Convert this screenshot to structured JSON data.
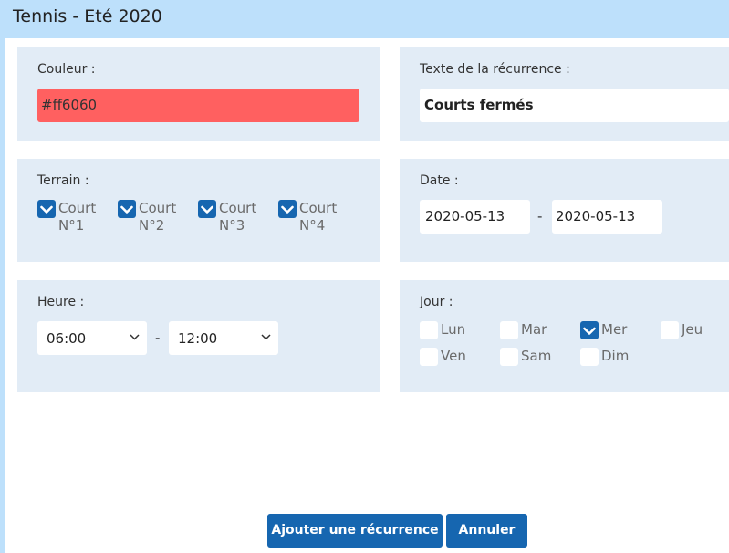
{
  "window": {
    "title": "Tennis - Eté 2020"
  },
  "couleur": {
    "label": "Couleur :",
    "value": "#ff6060",
    "swatch_color": "#ff6060"
  },
  "texte": {
    "label": "Texte de la récurrence :",
    "value": "Courts fermés"
  },
  "terrain": {
    "label": "Terrain :",
    "courts": [
      {
        "line1": "Court",
        "line2": "N°1",
        "checked": true
      },
      {
        "line1": "Court",
        "line2": "N°2",
        "checked": true
      },
      {
        "line1": "Court",
        "line2": "N°3",
        "checked": true
      },
      {
        "line1": "Court",
        "line2": "N°4",
        "checked": true
      }
    ]
  },
  "date": {
    "label": "Date :",
    "start": "2020-05-13",
    "separator": "-",
    "end": "2020-05-13"
  },
  "heure": {
    "label": "Heure :",
    "start": "06:00",
    "separator": "-",
    "end": "12:00"
  },
  "jour": {
    "label": "Jour :",
    "days": [
      {
        "label": "Lun",
        "checked": false
      },
      {
        "label": "Mar",
        "checked": false
      },
      {
        "label": "Mer",
        "checked": true
      },
      {
        "label": "Jeu",
        "checked": false
      },
      {
        "label": "Ven",
        "checked": false
      },
      {
        "label": "Sam",
        "checked": false
      },
      {
        "label": "Dim",
        "checked": false
      }
    ]
  },
  "buttons": {
    "add": "Ajouter une récurrence",
    "cancel": "Annuler"
  },
  "colors": {
    "accent": "#1666b0",
    "panel": "#e2ecf6",
    "titlebar": "#bde0fb"
  }
}
